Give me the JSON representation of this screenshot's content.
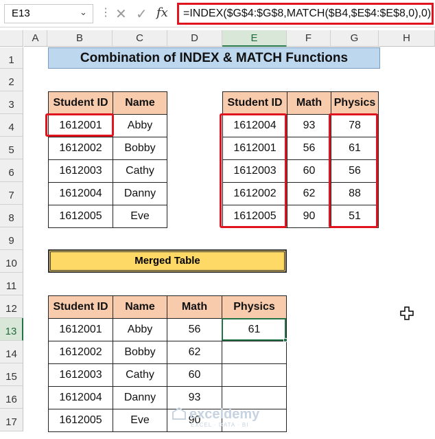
{
  "formula_bar": {
    "name_box": "E13",
    "fx": "fx",
    "formula": "=INDEX($G$4:$G$8,MATCH($B4,$E$4:$E$8,0),0)"
  },
  "columns": [
    "A",
    "B",
    "C",
    "D",
    "E",
    "F",
    "G",
    "H"
  ],
  "rows": [
    "1",
    "2",
    "3",
    "4",
    "5",
    "6",
    "7",
    "8",
    "9",
    "10",
    "11",
    "12",
    "13",
    "14",
    "15",
    "16",
    "17"
  ],
  "title": "Combination of INDEX & MATCH Functions",
  "table1": {
    "headers": [
      "Student ID",
      "Name"
    ],
    "rows": [
      [
        "1612001",
        "Abby"
      ],
      [
        "1612002",
        "Bobby"
      ],
      [
        "1612003",
        "Cathy"
      ],
      [
        "1612004",
        "Danny"
      ],
      [
        "1612005",
        "Eve"
      ]
    ]
  },
  "table2": {
    "headers": [
      "Student ID",
      "Math",
      "Physics"
    ],
    "rows": [
      [
        "1612004",
        "93",
        "78"
      ],
      [
        "1612001",
        "56",
        "61"
      ],
      [
        "1612003",
        "60",
        "56"
      ],
      [
        "1612002",
        "62",
        "88"
      ],
      [
        "1612005",
        "90",
        "51"
      ]
    ]
  },
  "merged_title": "Merged Table",
  "table3": {
    "headers": [
      "Student ID",
      "Name",
      "Math",
      "Physics"
    ],
    "rows": [
      [
        "1612001",
        "Abby",
        "56",
        "61"
      ],
      [
        "1612002",
        "Bobby",
        "62",
        ""
      ],
      [
        "1612003",
        "Cathy",
        "60",
        ""
      ],
      [
        "1612004",
        "Danny",
        "93",
        ""
      ],
      [
        "1612005",
        "Eve",
        "90",
        ""
      ]
    ]
  },
  "watermark": {
    "name": "exceldemy",
    "sub": "EXCEL · DATA · BI"
  },
  "colors": {
    "accent_red": "#e0141e",
    "header_fill": "#f8cbad",
    "title_fill": "#bdd7ee",
    "merged_fill": "#ffd966",
    "selection": "#217346"
  }
}
